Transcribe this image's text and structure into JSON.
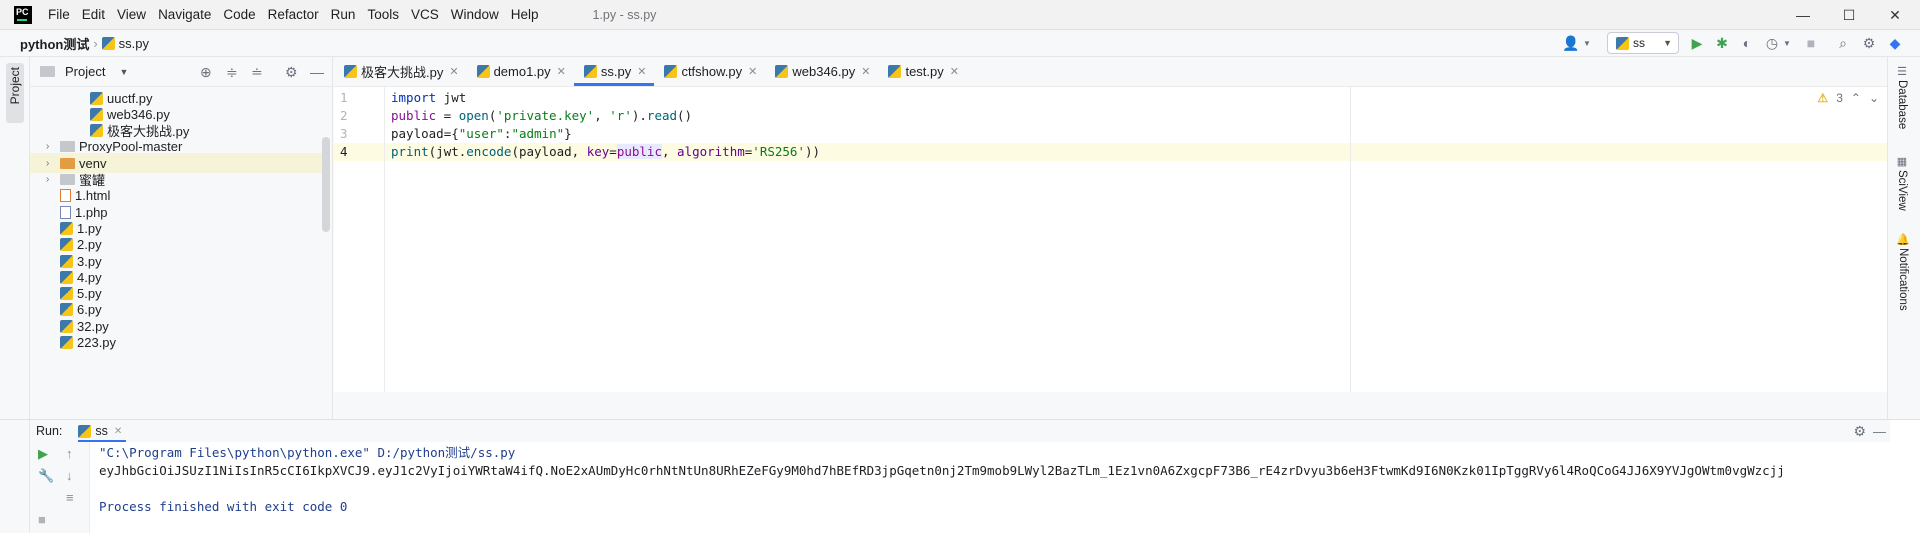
{
  "window": {
    "app_logo": "PC",
    "title": "1.py - ss.py",
    "menu": [
      "File",
      "Edit",
      "View",
      "Navigate",
      "Code",
      "Refactor",
      "Run",
      "Tools",
      "VCS",
      "Window",
      "Help"
    ],
    "controls": {
      "minimize": "—",
      "maximize": "☐",
      "close": "✕"
    }
  },
  "navbar": {
    "project": "python测试",
    "file": "ss.py",
    "run_config": "ss"
  },
  "left_strip": {
    "project_tab": "Project"
  },
  "project_panel": {
    "title": "Project",
    "tree": [
      {
        "name": "uuctf.py",
        "kind": "py",
        "indent": 2
      },
      {
        "name": "web346.py",
        "kind": "py",
        "indent": 2
      },
      {
        "name": "极客大挑战.py",
        "kind": "py",
        "indent": 2
      },
      {
        "name": "ProxyPool-master",
        "kind": "folder",
        "indent": 1,
        "expandable": true
      },
      {
        "name": "venv",
        "kind": "folder-orange",
        "indent": 1,
        "expandable": true,
        "selected": true
      },
      {
        "name": "蜜罐",
        "kind": "folder",
        "indent": 1,
        "expandable": true
      },
      {
        "name": "1.html",
        "kind": "html",
        "indent": 1
      },
      {
        "name": "1.php",
        "kind": "php",
        "indent": 1
      },
      {
        "name": "1.py",
        "kind": "py",
        "indent": 1
      },
      {
        "name": "2.py",
        "kind": "py",
        "indent": 1
      },
      {
        "name": "3.py",
        "kind": "py",
        "indent": 1
      },
      {
        "name": "4.py",
        "kind": "py",
        "indent": 1
      },
      {
        "name": "5.py",
        "kind": "py",
        "indent": 1
      },
      {
        "name": "6.py",
        "kind": "py",
        "indent": 1
      },
      {
        "name": "32.py",
        "kind": "py",
        "indent": 1
      },
      {
        "name": "223.py",
        "kind": "py",
        "indent": 1
      }
    ]
  },
  "editor_tabs": [
    {
      "label": "极客大挑战.py",
      "active": false
    },
    {
      "label": "demo1.py",
      "active": false
    },
    {
      "label": "ss.py",
      "active": true
    },
    {
      "label": "ctfshow.py",
      "active": false
    },
    {
      "label": "web346.py",
      "active": false
    },
    {
      "label": "test.py",
      "active": false
    }
  ],
  "editor": {
    "line_numbers": [
      "1",
      "2",
      "3",
      "4"
    ],
    "current_line": 4,
    "inspection_count": "3",
    "lines": [
      [
        {
          "t": "import",
          "c": "kw"
        },
        {
          "t": " jwt",
          "c": ""
        }
      ],
      [
        {
          "t": "public",
          "c": "bi"
        },
        {
          "t": " = ",
          "c": ""
        },
        {
          "t": "open",
          "c": "fn"
        },
        {
          "t": "(",
          "c": ""
        },
        {
          "t": "'private.key'",
          "c": "str"
        },
        {
          "t": ", ",
          "c": ""
        },
        {
          "t": "'r'",
          "c": "str"
        },
        {
          "t": ").",
          "c": ""
        },
        {
          "t": "read",
          "c": "fn"
        },
        {
          "t": "()",
          "c": ""
        }
      ],
      [
        {
          "t": "payload",
          "c": ""
        },
        {
          "t": "=",
          "c": ""
        },
        {
          "t": "{",
          "c": ""
        },
        {
          "t": "\"user\"",
          "c": "str"
        },
        {
          "t": ":",
          "c": ""
        },
        {
          "t": "\"admin\"",
          "c": "str"
        },
        {
          "t": "}",
          "c": ""
        }
      ],
      [
        {
          "t": "print",
          "c": "fn"
        },
        {
          "t": "(jwt.",
          "c": ""
        },
        {
          "t": "encode",
          "c": "fn"
        },
        {
          "t": "(payload, ",
          "c": ""
        },
        {
          "t": "key",
          "c": "par"
        },
        {
          "t": "=",
          "c": ""
        },
        {
          "t": "public",
          "c": "bi caret-hl"
        },
        {
          "t": ", ",
          "c": ""
        },
        {
          "t": "algorithm",
          "c": "par"
        },
        {
          "t": "=",
          "c": ""
        },
        {
          "t": "'RS256'",
          "c": "str"
        },
        {
          "t": "))",
          "c": ""
        }
      ]
    ]
  },
  "right_strip": [
    "Database",
    "SciView",
    "Notifications"
  ],
  "run_panel": {
    "label": "Run:",
    "tab": "ss",
    "console": [
      {
        "text": "\"C:\\Program Files\\python\\python.exe\" D:/python测试/ss.py",
        "kind": "cmd"
      },
      {
        "text": "eyJhbGciOiJSUzI1NiIsInR5cCI6IkpXVCJ9.eyJ1c2VyIjoiYWRtaW4ifQ.NoE2xAUmDyHc0rhNtNtUn8URhEZeFGy9M0hd7hBEfRD3jpGqetn0nj2Tm9mob9LWyl2BazTLm_1Ez1vn0A6ZxgcpF73B6_rE4zrDvyu3b6eH3FtwmKd9I6N0Kzk01IpTggRVy6l4RoQCoG4JJ6X9YVJgOWtm0vgWzcjj",
        "kind": "out"
      },
      {
        "text": "",
        "kind": "out"
      },
      {
        "text": "Process finished with exit code 0",
        "kind": "exit"
      }
    ]
  }
}
